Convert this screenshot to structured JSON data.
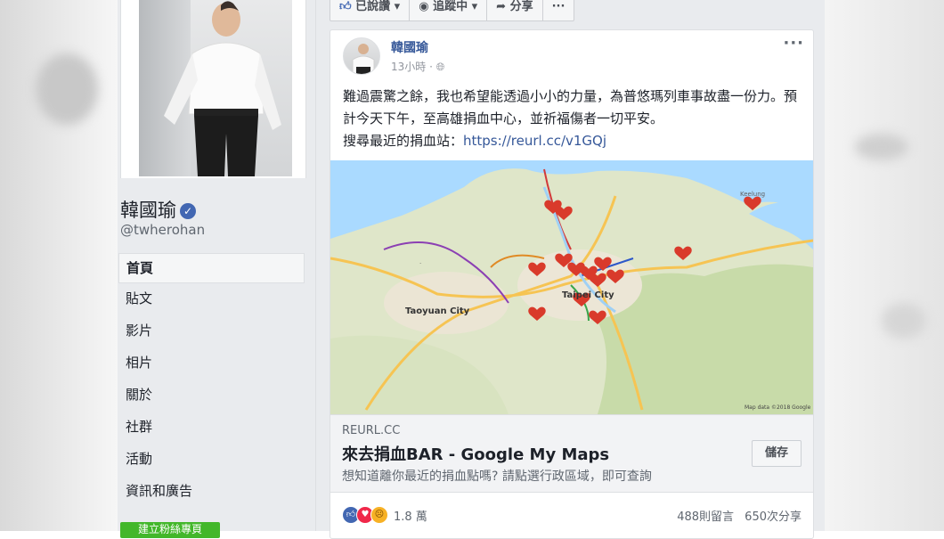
{
  "left_column": {
    "page_name": "韓國瑜",
    "handle": "@twherohan",
    "nav": [
      {
        "label": "首頁",
        "active": true
      },
      {
        "label": "貼文"
      },
      {
        "label": "影片"
      },
      {
        "label": "相片"
      },
      {
        "label": "關於"
      },
      {
        "label": "社群"
      },
      {
        "label": "活動"
      },
      {
        "label": "資訊和廣告"
      }
    ],
    "green_button": "建立粉絲專頁"
  },
  "action_bar": {
    "liked": "已說讚",
    "following": "追蹤中",
    "share": "分享",
    "more": "···"
  },
  "post": {
    "author": "韓國瑜",
    "time": "13小時",
    "more": "···",
    "text_line1": "難過震驚之餘，我也希望能透過小小的力量，為普悠瑪列車事故盡一份力。預計今天下午，至高雄捐血中心，並祈福傷者一切平安。",
    "text_line2_prefix": "搜尋最近的捐血站：",
    "text_link": "https://reurl.cc/v1GQj",
    "map": {
      "city_label": "Taoyuan City",
      "attribution": "Map data ©2018 Google",
      "keelung_label": "Keelung"
    },
    "link": {
      "domain": "REURL.CC",
      "title": "來去捐血BAR - Google My Maps",
      "description": "想知道離你最近的捐血點嗎? 請點選行政區域，即可查詢",
      "save_label": "儲存"
    },
    "reactions_count": "1.8 萬",
    "comments": "488則留言",
    "shares": "650次分享"
  },
  "colors": {
    "facebook_blue": "#4267b2",
    "link_blue": "#365899",
    "heart_red": "#d93a2b",
    "green": "#42b72a"
  }
}
